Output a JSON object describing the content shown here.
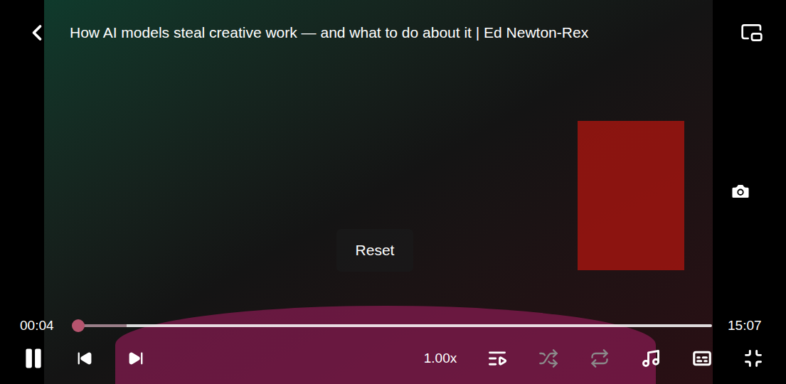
{
  "top_bar": {
    "title": "How AI models steal creative work — and what to do about it | Ed Newton-Rex"
  },
  "tooltip": {
    "label": "Reset"
  },
  "seek_bar": {
    "current": "00:04",
    "duration": "15:07",
    "level": 0.0044,
    "buffered": 0.08
  },
  "controls": {
    "playing": true,
    "speed": "1.00x",
    "shuffle": {
      "on": false
    },
    "repeat": {
      "on": false
    }
  }
}
